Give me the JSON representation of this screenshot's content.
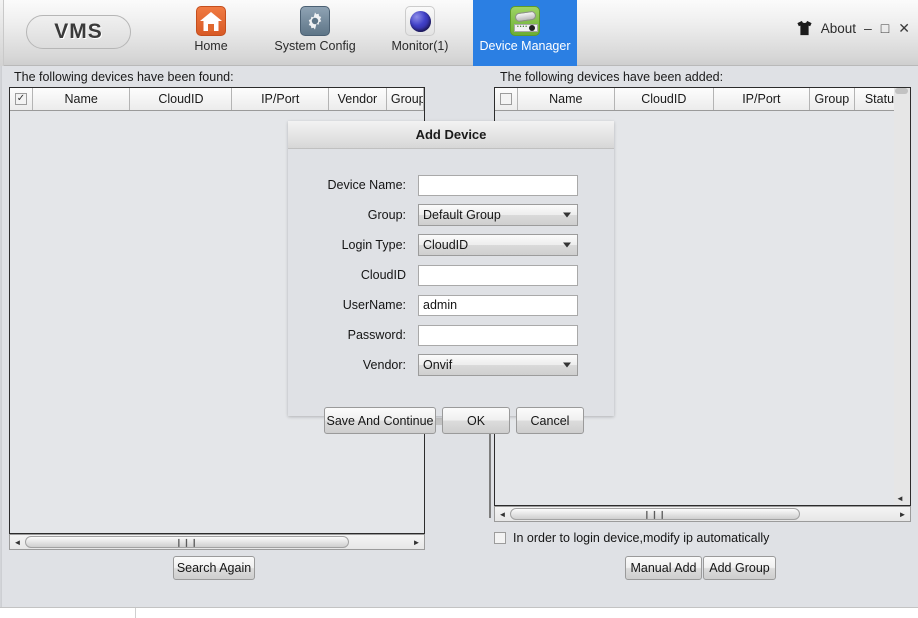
{
  "window": {
    "title": "VMS",
    "controls": {
      "minimize": "–",
      "maximize": "□",
      "close": "✕"
    }
  },
  "toolbar": {
    "logo_text": "VMS",
    "about_label": "About",
    "about_icon": "tshirt-icon",
    "tabs": [
      {
        "label": "Home",
        "icon": "home-icon",
        "active": false
      },
      {
        "label": "System Config",
        "icon": "gear-icon",
        "active": false
      },
      {
        "label": "Monitor(1)",
        "icon": "sphere-monitor-icon",
        "active": false
      },
      {
        "label": "Device Manager",
        "icon": "device-camera-icon",
        "active": true
      }
    ],
    "active_tab_color": "#2b7fe3"
  },
  "found_panel": {
    "caption": "The following devices have been found:",
    "select_all_checked": true,
    "select_all_glyph": "✓",
    "columns": [
      "Name",
      "CloudID",
      "IP/Port",
      "Vendor",
      "Group"
    ],
    "rows": [],
    "hscroll": {
      "left_arrow": "◄",
      "right_arrow": "►",
      "grip": "❙❙❙"
    },
    "search_again_label": "Search Again"
  },
  "added_panel": {
    "caption": "The following devices have been added:",
    "select_all_checked": false,
    "columns": [
      "Name",
      "CloudID",
      "IP/Port",
      "Group",
      "Status"
    ],
    "rows": [],
    "hscroll": {
      "left_arrow": "◄",
      "right_arrow": "►",
      "grip": "❙❙❙"
    },
    "vscroll": {
      "down_arrow": "◄"
    },
    "auto_ip_checkbox": {
      "label": "In order to login device,modify ip automatically",
      "checked": false
    },
    "manual_add_label": "Manual Add",
    "add_group_label": "Add Group"
  },
  "add_device_dialog": {
    "title": "Add Device",
    "fields": [
      {
        "label": "Device Name:",
        "type": "text",
        "value": "",
        "placeholder": ""
      },
      {
        "label": "Group:",
        "type": "select",
        "value": "Default Group"
      },
      {
        "label": "Login Type:",
        "type": "select",
        "value": "CloudID"
      },
      {
        "label": "CloudID",
        "type": "text",
        "value": "",
        "placeholder": ""
      },
      {
        "label": "UserName:",
        "type": "text",
        "value": "admin",
        "placeholder": ""
      },
      {
        "label": "Password:",
        "type": "text",
        "value": "",
        "placeholder": ""
      },
      {
        "label": "Vendor:",
        "type": "select",
        "value": "Onvif"
      }
    ],
    "buttons": {
      "save_and_continue": "Save And Continue",
      "ok": "OK",
      "cancel": "Cancel"
    }
  },
  "colors": {
    "app_background": "#dfe1e5",
    "toolbar_light": "#fbfbfb",
    "accent_blue": "#2b7fe3",
    "home_orange": "#e0682f",
    "device_green": "#7ec03c",
    "table_border": "#2c2c2c"
  }
}
